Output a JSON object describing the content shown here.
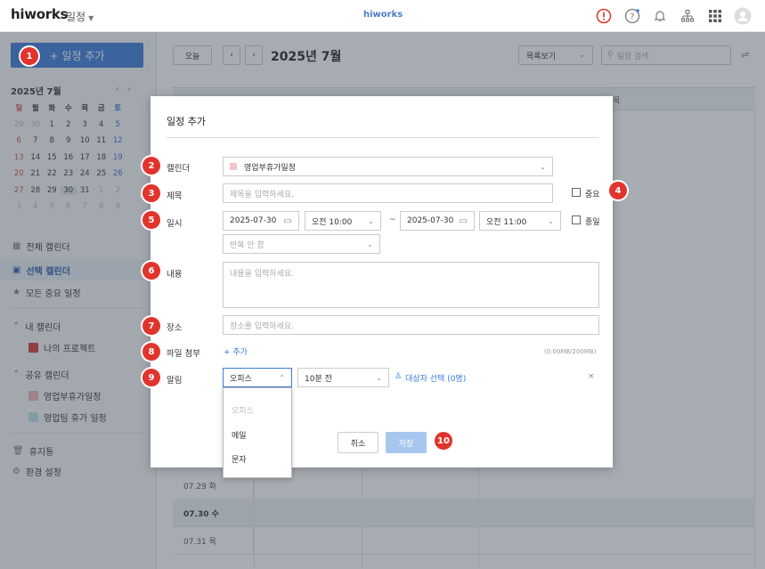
{
  "header": {
    "logo": "hiworks",
    "app_name": "일정",
    "center_brand": "hiworks"
  },
  "sidebar": {
    "add_button": "+ 일정 추가",
    "mini_cal": {
      "title": "2025년 7월",
      "weekdays": [
        "일",
        "월",
        "화",
        "수",
        "목",
        "금",
        "토"
      ],
      "weeks": [
        [
          "29",
          "30",
          "1",
          "2",
          "3",
          "4",
          "5"
        ],
        [
          "6",
          "7",
          "8",
          "9",
          "10",
          "11",
          "12"
        ],
        [
          "13",
          "14",
          "15",
          "16",
          "17",
          "18",
          "19"
        ],
        [
          "20",
          "21",
          "22",
          "23",
          "24",
          "25",
          "26"
        ],
        [
          "27",
          "28",
          "29",
          "30",
          "31",
          "1",
          "2"
        ],
        [
          "3",
          "4",
          "5",
          "6",
          "7",
          "8",
          "9"
        ]
      ]
    },
    "nav": {
      "all": "전체 캘린더",
      "selected": "선택 캘린더",
      "important": "모든 중요 일정"
    },
    "my_cal_header": "내 캘린더",
    "my_cals": [
      "나의 프로젝트"
    ],
    "shared_header": "공유 캘린더",
    "shared_cals": [
      "영업부휴가일정",
      "영업팀 휴가 일정"
    ],
    "trash": "휴지통",
    "settings": "환경 설정"
  },
  "main": {
    "today_button": "오늘",
    "month_title": "2025년 7월",
    "view_select": "목록보기",
    "search_placeholder": "일정 검색",
    "visible_column": "목",
    "rows": [
      "07.29 화",
      "07.30 수",
      "07.31 목"
    ]
  },
  "modal": {
    "title": "일정 추가",
    "calendar_label": "캘린더",
    "calendar_value": "영업부휴가일정",
    "calendar_color": "#f4c6cc",
    "subject_label": "제목",
    "subject_placeholder": "제목을 입력하세요.",
    "important_label": "중요",
    "datetime_label": "일시",
    "start_date": "2025-07-30",
    "start_time": "오전 10:00",
    "tilde": "~",
    "end_date": "2025-07-30",
    "end_time": "오전 11:00",
    "allday_label": "종일",
    "repeat_value": "반복 안 함",
    "content_label": "내용",
    "content_placeholder": "내용을 입력하세요.",
    "place_label": "장소",
    "place_placeholder": "장소를 입력하세요.",
    "file_label": "파일 첨부",
    "file_add": "+ 추가",
    "file_size": "(0.00MB/200MB)",
    "alarm_label": "알림",
    "alarm_type": "오피스",
    "alarm_time": "10분 전",
    "alarm_target": "대상자 선택 (0명)",
    "alarm_options": [
      "오피스",
      "메일",
      "문자"
    ],
    "cancel": "취소",
    "save": "저장"
  },
  "badges": [
    "1",
    "2",
    "3",
    "4",
    "5",
    "6",
    "7",
    "8",
    "9",
    "10"
  ],
  "colors": {
    "accent": "#3b7bd9",
    "badge": "#e0342d",
    "sunday": "#d64545",
    "saturday": "#3b6fc4"
  }
}
